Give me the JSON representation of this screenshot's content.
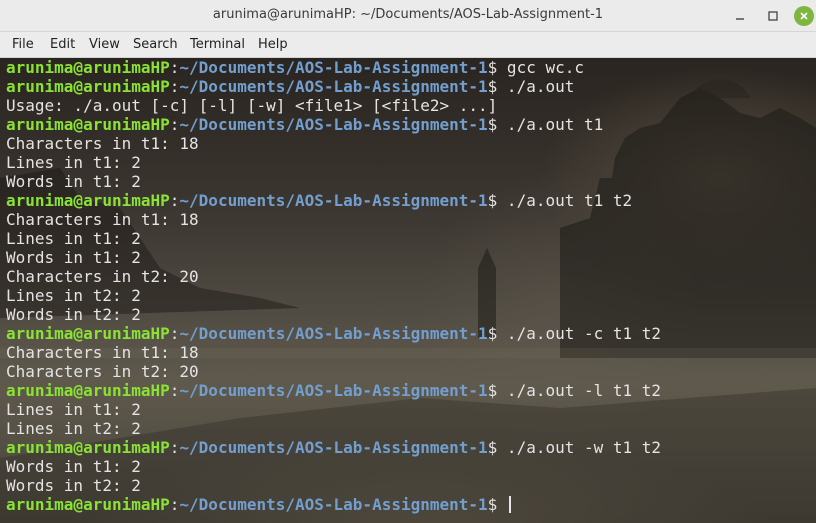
{
  "window": {
    "title": "arunima@arunimaHP: ~/Documents/AOS-Lab-Assignment-1",
    "controls": [
      "minimize-icon",
      "maximize-icon",
      "close-icon"
    ]
  },
  "menubar": {
    "items": [
      "File",
      "Edit",
      "View",
      "Search",
      "Terminal",
      "Help"
    ]
  },
  "terminal": {
    "colors": {
      "user": "#8ae234",
      "path": "#729fcf",
      "text": "#e4e4e4"
    },
    "prompt": {
      "user": "arunima@arunimaHP",
      "colon": ":",
      "path": "~/Documents/AOS-Lab-Assignment-1",
      "symbol": "$"
    },
    "lines": [
      {
        "type": "prompt",
        "cmd": " gcc wc.c"
      },
      {
        "type": "prompt",
        "cmd": " ./a.out"
      },
      {
        "type": "output",
        "text": "Usage: ./a.out [-c] [-l] [-w] <file1> [<file2> ...]"
      },
      {
        "type": "prompt",
        "cmd": " ./a.out t1"
      },
      {
        "type": "output",
        "text": "Characters in t1: 18"
      },
      {
        "type": "output",
        "text": "Lines in t1: 2"
      },
      {
        "type": "output",
        "text": "Words in t1: 2"
      },
      {
        "type": "prompt",
        "cmd": " ./a.out t1 t2"
      },
      {
        "type": "output",
        "text": "Characters in t1: 18"
      },
      {
        "type": "output",
        "text": "Lines in t1: 2"
      },
      {
        "type": "output",
        "text": "Words in t1: 2"
      },
      {
        "type": "output",
        "text": "Characters in t2: 20"
      },
      {
        "type": "output",
        "text": "Lines in t2: 2"
      },
      {
        "type": "output",
        "text": "Words in t2: 2"
      },
      {
        "type": "prompt",
        "cmd": " ./a.out -c t1 t2"
      },
      {
        "type": "output",
        "text": "Characters in t1: 18"
      },
      {
        "type": "output",
        "text": "Characters in t2: 20"
      },
      {
        "type": "prompt",
        "cmd": " ./a.out -l t1 t2"
      },
      {
        "type": "output",
        "text": "Lines in t1: 2"
      },
      {
        "type": "output",
        "text": "Lines in t2: 2"
      },
      {
        "type": "prompt",
        "cmd": " ./a.out -w t1 t2"
      },
      {
        "type": "output",
        "text": "Words in t1: 2"
      },
      {
        "type": "output",
        "text": "Words in t2: 2"
      },
      {
        "type": "prompt",
        "cmd": " ",
        "cursor": true
      }
    ]
  }
}
